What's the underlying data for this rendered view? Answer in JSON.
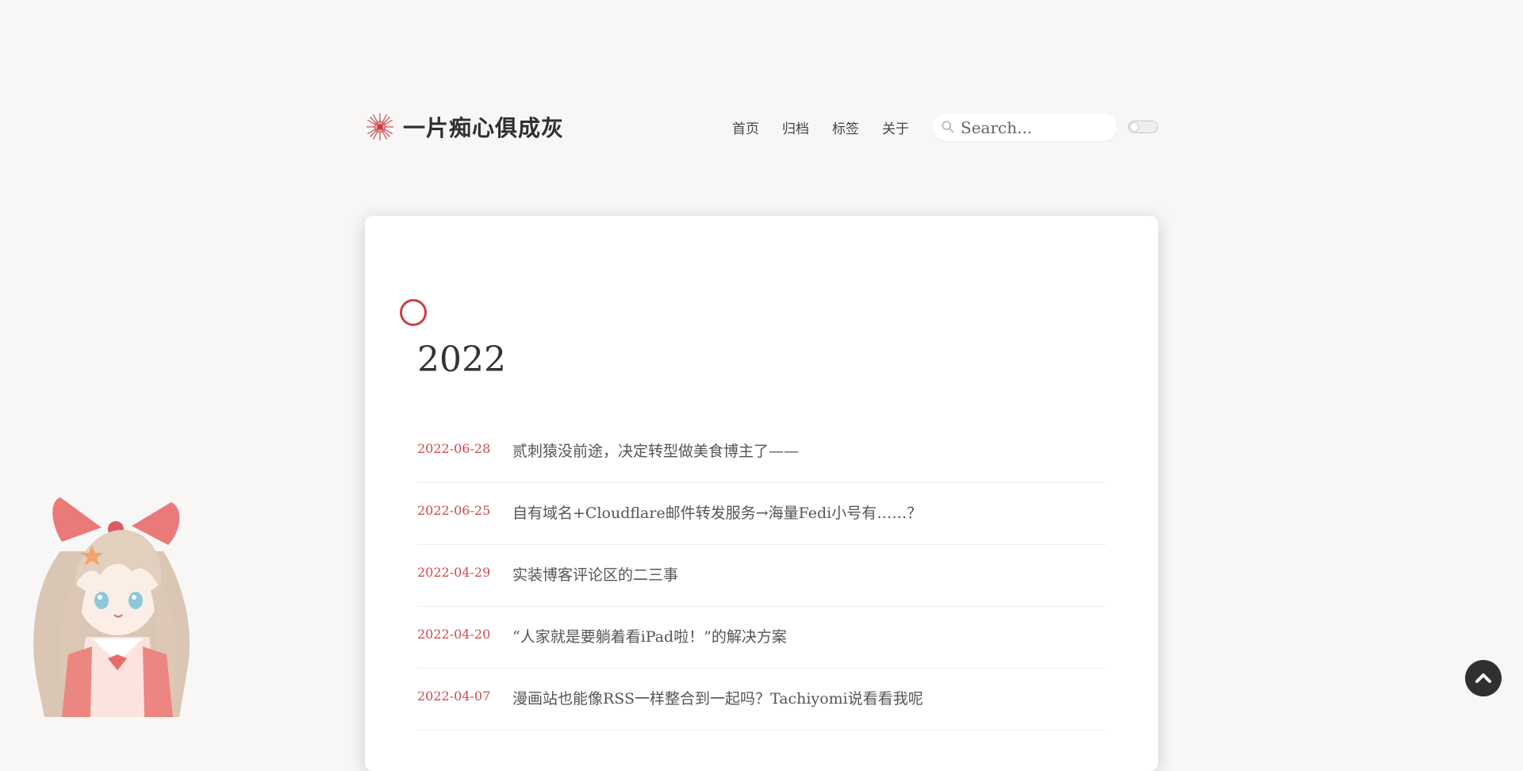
{
  "site": {
    "title": "一片痴心俱成灰",
    "logo_icon": "sunburst-icon",
    "accent_color": "#cf3e42"
  },
  "nav": {
    "items": [
      {
        "label": "首页"
      },
      {
        "label": "归档"
      },
      {
        "label": "标签"
      },
      {
        "label": "关于"
      }
    ]
  },
  "search": {
    "placeholder": "Search...",
    "icon": "search-icon"
  },
  "theme_toggle": {
    "state": "off"
  },
  "archive": {
    "year": "2022",
    "posts": [
      {
        "date": "2022-06-28",
        "title": "贰刺猿没前途，决定转型做美食博主了——"
      },
      {
        "date": "2022-06-25",
        "title": "自有域名+Cloudflare邮件转发服务→海量Fedi小号有……？"
      },
      {
        "date": "2022-04-29",
        "title": "实装博客评论区的二三事"
      },
      {
        "date": "2022-04-20",
        "title": "“人家就是要躺着看iPad啦！”的解决方案"
      },
      {
        "date": "2022-04-07",
        "title": "漫画站也能像RSS一样整合到一起吗？Tachiyomi说看看我呢"
      }
    ]
  },
  "back_to_top": {
    "icon": "chevron-up-icon"
  }
}
